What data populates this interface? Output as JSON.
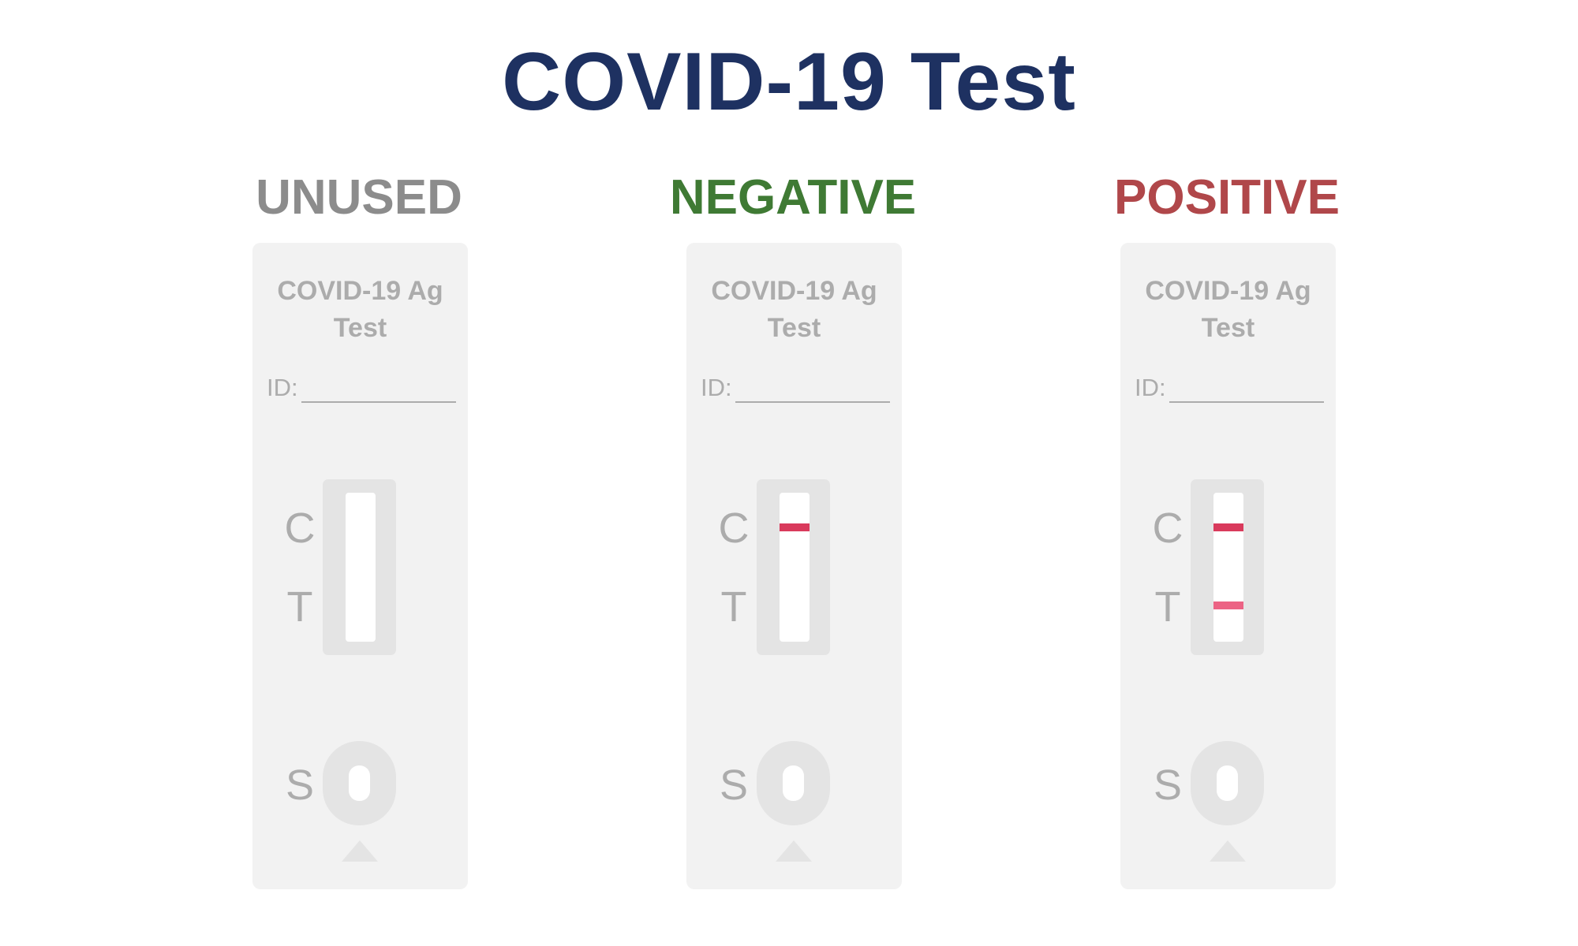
{
  "title": "COVID-19 Test",
  "colors": {
    "title": "#1e3161",
    "cassette_text": "#acacac",
    "cassette_bg": "#f2f2f2",
    "window_bg": "#e4e4e4"
  },
  "cassette_label": {
    "line1": "COVID-19 Ag",
    "line2": "Test",
    "id_label": "ID:",
    "control_letter": "C",
    "test_letter": "T",
    "sample_letter": "S"
  },
  "panels": [
    {
      "status": "UNUSED",
      "status_color": "#8c8c8c",
      "control_line": false,
      "test_line": false
    },
    {
      "status": "NEGATIVE",
      "status_color": "#3f7a34",
      "control_line": true,
      "control_color": "#d93a5c",
      "test_line": false
    },
    {
      "status": "POSITIVE",
      "status_color": "#b0474a",
      "control_line": true,
      "control_color": "#d93a5c",
      "test_line": true,
      "test_color": "#ec6384"
    }
  ]
}
